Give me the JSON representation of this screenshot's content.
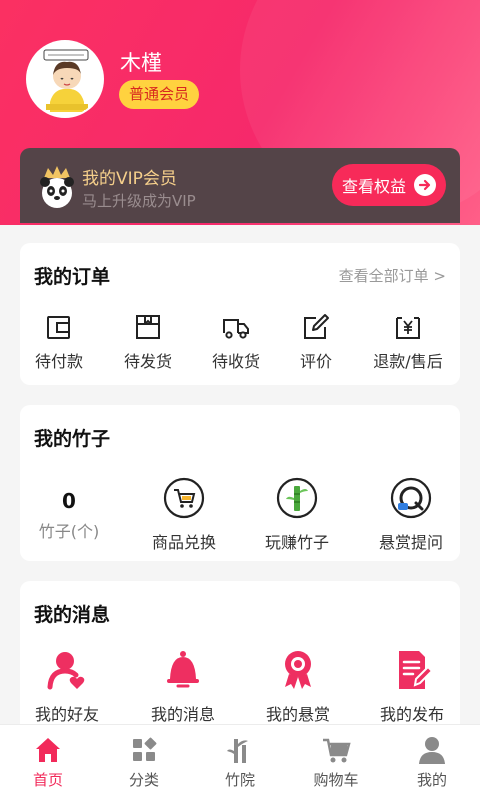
{
  "profile": {
    "name": "木槿",
    "member_level": "普通会员"
  },
  "vip": {
    "title": "我的VIP会员",
    "subtitle": "马上升级成为VIP",
    "button_label": "查看权益"
  },
  "orders": {
    "title": "我的订单",
    "view_all": "查看全部订单 >",
    "items": [
      {
        "label": "待付款",
        "icon": "wallet-icon"
      },
      {
        "label": "待发货",
        "icon": "box-icon"
      },
      {
        "label": "待收货",
        "icon": "truck-icon"
      },
      {
        "label": "评价",
        "icon": "edit-icon"
      },
      {
        "label": "退款/售后",
        "icon": "refund-icon"
      }
    ]
  },
  "bamboo": {
    "title": "我的竹子",
    "count": "0",
    "count_label": "竹子(个)",
    "items": [
      {
        "label": "商品兑换",
        "icon": "cart-circle-icon"
      },
      {
        "label": "玩赚竹子",
        "icon": "bamboo-circle-icon"
      },
      {
        "label": "悬赏提问",
        "icon": "question-circle-icon"
      }
    ]
  },
  "messages": {
    "title": "我的消息",
    "items": [
      {
        "label": "我的好友",
        "icon": "friend-icon"
      },
      {
        "label": "我的消息",
        "icon": "bell-icon"
      },
      {
        "label": "我的悬赏",
        "icon": "award-icon"
      },
      {
        "label": "我的发布",
        "icon": "publish-icon"
      }
    ]
  },
  "bottom_nav": {
    "items": [
      {
        "label": "首页",
        "icon": "home-icon",
        "active": true
      },
      {
        "label": "分类",
        "icon": "category-icon",
        "active": false
      },
      {
        "label": "竹院",
        "icon": "bamboo-yard-icon",
        "active": false
      },
      {
        "label": "购物车",
        "icon": "cart-icon",
        "active": false
      },
      {
        "label": "我的",
        "icon": "user-icon",
        "active": false
      }
    ]
  },
  "colors": {
    "brand": "#f72a59",
    "header_gradient_start": "#fb3062",
    "vip_card_bg": "#544448",
    "vip_gold": "#f5cf8b",
    "badge_yellow": "#ffd23f",
    "active_nav": "#f22a5a"
  }
}
